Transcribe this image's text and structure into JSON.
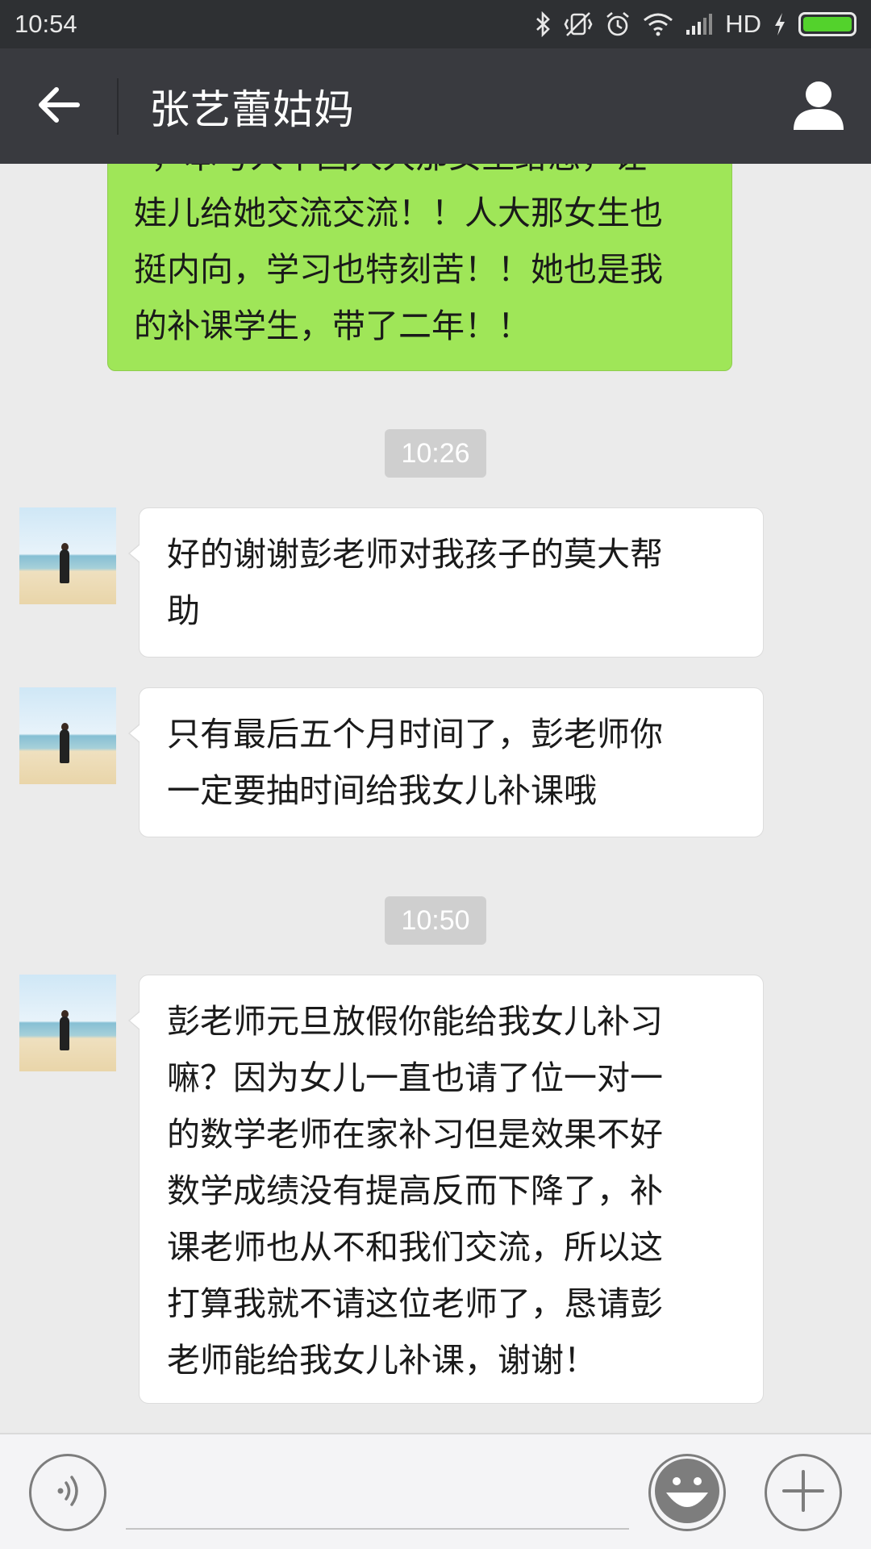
{
  "status_bar": {
    "time": "10:54",
    "network_label": "HD",
    "battery_level": 1.0,
    "icons": [
      "bluetooth-icon",
      "vibrate-icon",
      "alarm-icon",
      "wifi-icon",
      "signal-icon",
      "charging-icon",
      "battery-icon"
    ]
  },
  "nav": {
    "title": "张艺蕾姑妈",
    "back_icon": "arrow-left-icon",
    "profile_icon": "person-icon"
  },
  "messages": [
    {
      "direction": "outgoing",
      "lines": [
        "”，本号人中国人大那女生给您，让",
        "娃儿给她交流交流！！人大那女生也",
        "挺内向，学习也特刻苦！！她也是我",
        "的补课学生，带了二年！！"
      ]
    },
    {
      "type": "timestamp",
      "text": "10:26"
    },
    {
      "direction": "incoming",
      "lines": [
        "好的谢谢彭老师对我孩子的莫大帮",
        "助"
      ]
    },
    {
      "direction": "incoming",
      "lines": [
        "只有最后五个月时间了，彭老师你",
        "一定要抽时间给我女儿补课哦"
      ]
    },
    {
      "type": "timestamp",
      "text": "10:50"
    },
    {
      "direction": "incoming",
      "lines": [
        "彭老师元旦放假你能给我女儿补习",
        "嘛？因为女儿一直也请了位一对一",
        "的数学老师在家补习但是效果不好",
        "数学成绩没有提高反而下降了，补",
        "课老师也从不和我们交流，所以这",
        "打算我就不请这位老师了，恳请彭",
        "老师能给我女儿补课，谢谢！"
      ]
    }
  ],
  "input_bar": {
    "voice_icon": "voice-icon",
    "emoji_icon": "emoji-icon",
    "plus_icon": "plus-icon"
  },
  "colors": {
    "status_bar_bg": "#2e3033",
    "nav_bg": "#393a3f",
    "chat_bg": "#ebebeb",
    "outgoing_bubble": "#9fe658",
    "incoming_bubble": "#ffffff",
    "battery_fill": "#53d22c"
  }
}
